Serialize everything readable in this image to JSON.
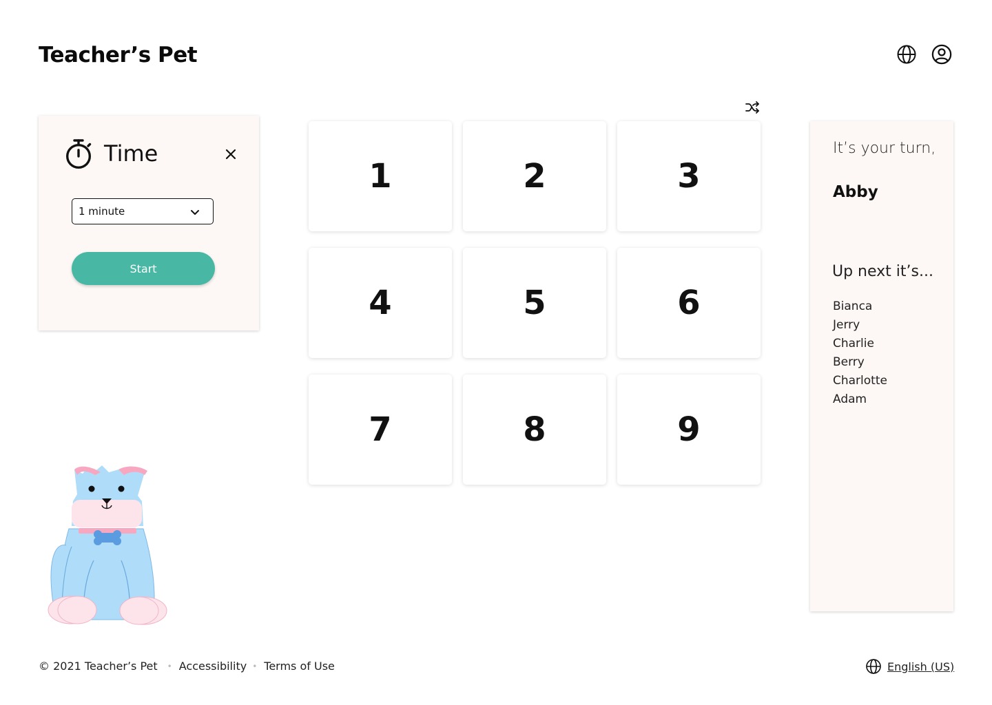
{
  "header": {
    "app_title": "Teacher’s Pet",
    "icons": [
      "globe-icon",
      "user-circle-icon"
    ]
  },
  "timer": {
    "title": "Time",
    "duration_selected": "1 minute",
    "start_label": "Start"
  },
  "grid": {
    "tiles": [
      "1",
      "2",
      "3",
      "4",
      "5",
      "6",
      "7",
      "8",
      "9"
    ]
  },
  "turn": {
    "label": "It’s your turn,",
    "current": "Abby",
    "next_label": "Up next it’s...",
    "next": [
      "Bianca",
      "Jerry",
      "Charlie",
      "Berry",
      "Charlotte",
      "Adam"
    ]
  },
  "footer": {
    "copyright": "© 2021 Teacher’s Pet",
    "links": [
      "Accessibility",
      "Terms of Use"
    ],
    "language": "English (US)"
  },
  "colors": {
    "accent": "#48b8a4",
    "card_bg": "#fdf8f5",
    "dog_blue": "#aedcf9",
    "dog_pink": "#fce4ea"
  }
}
